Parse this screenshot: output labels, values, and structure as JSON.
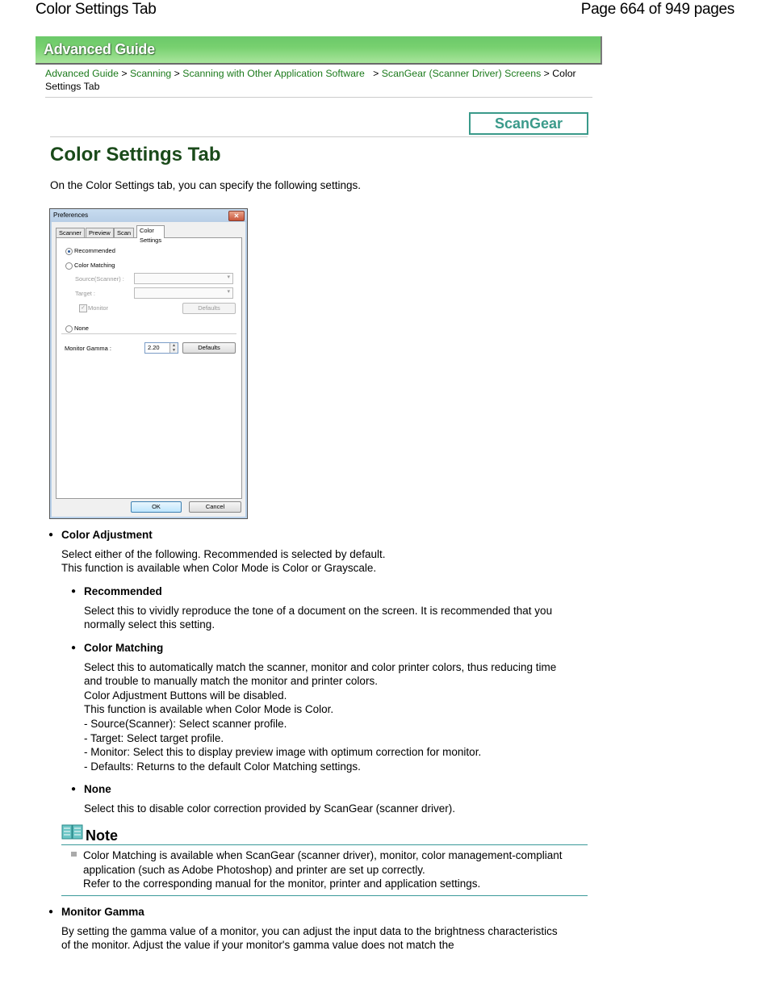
{
  "header": {
    "title": "Color Settings Tab",
    "page_info": "Page 664 of 949 pages"
  },
  "banner": {
    "label": "Advanced Guide"
  },
  "breadcrumb": {
    "links": [
      "Advanced Guide",
      "Scanning",
      "Scanning with Other Application Software",
      "ScanGear (Scanner Driver) Screens"
    ],
    "separator": ">",
    "current": "Color Settings Tab"
  },
  "scangear_button": "ScanGear",
  "page_title": "Color Settings Tab",
  "intro": "On the Color Settings tab, you can specify the following settings.",
  "dialog": {
    "title": "Preferences",
    "close": "✕",
    "tabs": [
      "Scanner",
      "Preview",
      "Scan",
      "Color Settings"
    ],
    "active_tab": "Color Settings",
    "recommended": "Recommended",
    "color_matching": "Color Matching",
    "source_label": "Source(Scanner) :",
    "target_label": "Target :",
    "monitor_label": "Monitor",
    "defaults": "Defaults",
    "none": "None",
    "monitor_gamma_label": "Monitor Gamma :",
    "monitor_gamma_value": "2.20",
    "ok": "OK",
    "cancel": "Cancel"
  },
  "sections": {
    "color_adjustment": {
      "title": "Color Adjustment",
      "text": [
        "Select either of the following. Recommended is selected by default.",
        "This function is available when Color Mode is Color or Grayscale."
      ]
    },
    "recommended": {
      "title": "Recommended",
      "text": [
        "Select this to vividly reproduce the tone of a document on the screen. It is recommended that you normally select this setting."
      ]
    },
    "color_matching": {
      "title": "Color Matching",
      "text": [
        "Select this to automatically match the scanner, monitor and color printer colors, thus reducing time and trouble to manually match the monitor and printer colors.",
        "Color Adjustment Buttons will be disabled.",
        "This function is available when Color Mode is Color.",
        "- Source(Scanner): Select scanner profile.",
        "- Target: Select target profile.",
        "- Monitor: Select this to display preview image with optimum correction for monitor.",
        "- Defaults: Returns to the default Color Matching settings."
      ]
    },
    "none": {
      "title": "None",
      "text": [
        "Select this to disable color correction provided by ScanGear (scanner driver)."
      ]
    },
    "note": {
      "title": "Note",
      "text": [
        "Color Matching is available when ScanGear (scanner driver), monitor, color management-compliant application (such as Adobe Photoshop) and printer are set up correctly.",
        "Refer to the corresponding manual for the monitor, printer and application settings."
      ]
    },
    "monitor_gamma": {
      "title": "Monitor Gamma",
      "text": [
        "By setting the gamma value of a monitor, you can adjust the input data to the brightness characteristics of the monitor. Adjust the value if your monitor's gamma value does not match the"
      ]
    }
  },
  "colors": {
    "link": "#1b7a1b",
    "title": "#1a4a1a",
    "accent_teal": "#3a9a8a",
    "banner_green": "#6bc96a"
  }
}
